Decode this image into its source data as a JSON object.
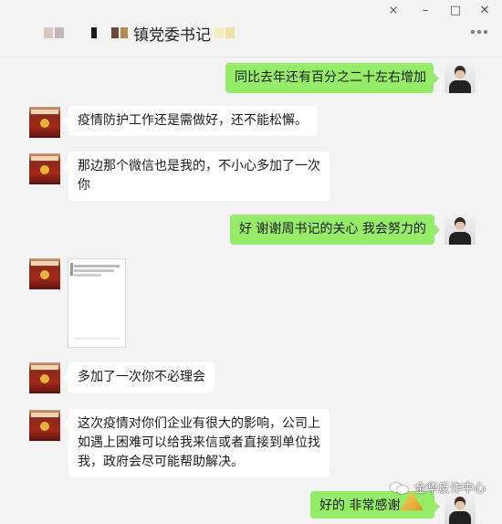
{
  "header": {
    "title": "镇党委书记"
  },
  "messages": [
    {
      "side": "out",
      "lines": [
        "同比去年还有百分之二十左右增加"
      ]
    },
    {
      "side": "in",
      "lines": [
        "疫情防护工作还是需做好，还不能松懈。"
      ]
    },
    {
      "side": "in",
      "lines": [
        "那边那个微信也是我的，不小心多加了一次",
        "你"
      ]
    },
    {
      "side": "out",
      "lines": [
        "好 谢谢周书记的关心 我会努力的"
      ]
    },
    {
      "side": "in",
      "type": "image"
    },
    {
      "side": "in",
      "lines": [
        "多加了一次你不必理会"
      ]
    },
    {
      "side": "in",
      "lines": [
        "这次疫情对你们企业有很大的影响，公司上",
        "如遇上困难可以给我来信或者直接到单位找",
        "我，政府会尽可能帮助解决。"
      ]
    },
    {
      "side": "out",
      "lines": [
        "好的 非常感谢"
      ]
    }
  ],
  "watermark": {
    "text": "金华反诈中心"
  },
  "colors": {
    "outgoing_bubble": "#95ec69",
    "incoming_bubble": "#ffffff",
    "background": "#f3f3f3"
  },
  "icons": [
    "pin-icon",
    "minimize-icon",
    "maximize-icon",
    "close-icon",
    "more-options-icon",
    "wechat-icon"
  ]
}
